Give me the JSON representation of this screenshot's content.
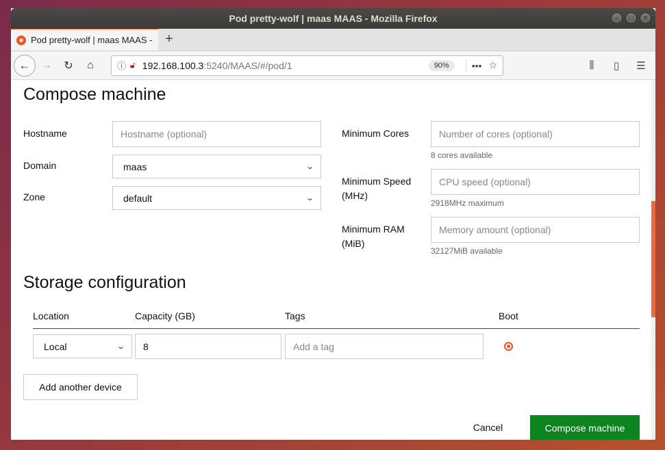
{
  "window": {
    "title": "Pod pretty-wolf | maas MAAS - Mozilla Firefox"
  },
  "tab": {
    "label": "Pod pretty-wolf | maas MAAS - Mozilla Firefox",
    "favicon": "ubuntu-favicon"
  },
  "url": {
    "host": "192.168.100.3",
    "path": ":5240/MAAS/#/pod/1",
    "zoom": "90%"
  },
  "compose": {
    "title": "Compose machine",
    "hostname": {
      "label": "Hostname",
      "placeholder": "Hostname (optional)"
    },
    "domain": {
      "label": "Domain",
      "value": "maas"
    },
    "zone": {
      "label": "Zone",
      "value": "default"
    },
    "cores": {
      "label": "Minimum Cores",
      "placeholder": "Number of cores (optional)",
      "help": "8 cores available"
    },
    "speed": {
      "label_line1": "Minimum Speed",
      "label_line2": "(MHz)",
      "placeholder": "CPU speed (optional)",
      "help": "2918MHz maximum"
    },
    "ram": {
      "label_line1": "Minimum RAM",
      "label_line2": "(MiB)",
      "placeholder": "Memory amount (optional)",
      "help": "32127MiB available"
    }
  },
  "storage": {
    "title": "Storage configuration",
    "columns": [
      "Location",
      "Capacity (GB)",
      "Tags",
      "Boot"
    ],
    "row": {
      "location": "Local",
      "capacity": "8",
      "tags_placeholder": "Add a tag",
      "boot": true
    },
    "add_device": "Add another device"
  },
  "actions": {
    "cancel": "Cancel",
    "submit": "Compose machine"
  },
  "colors": {
    "accent": "#e95420",
    "positive": "#0e8420"
  }
}
